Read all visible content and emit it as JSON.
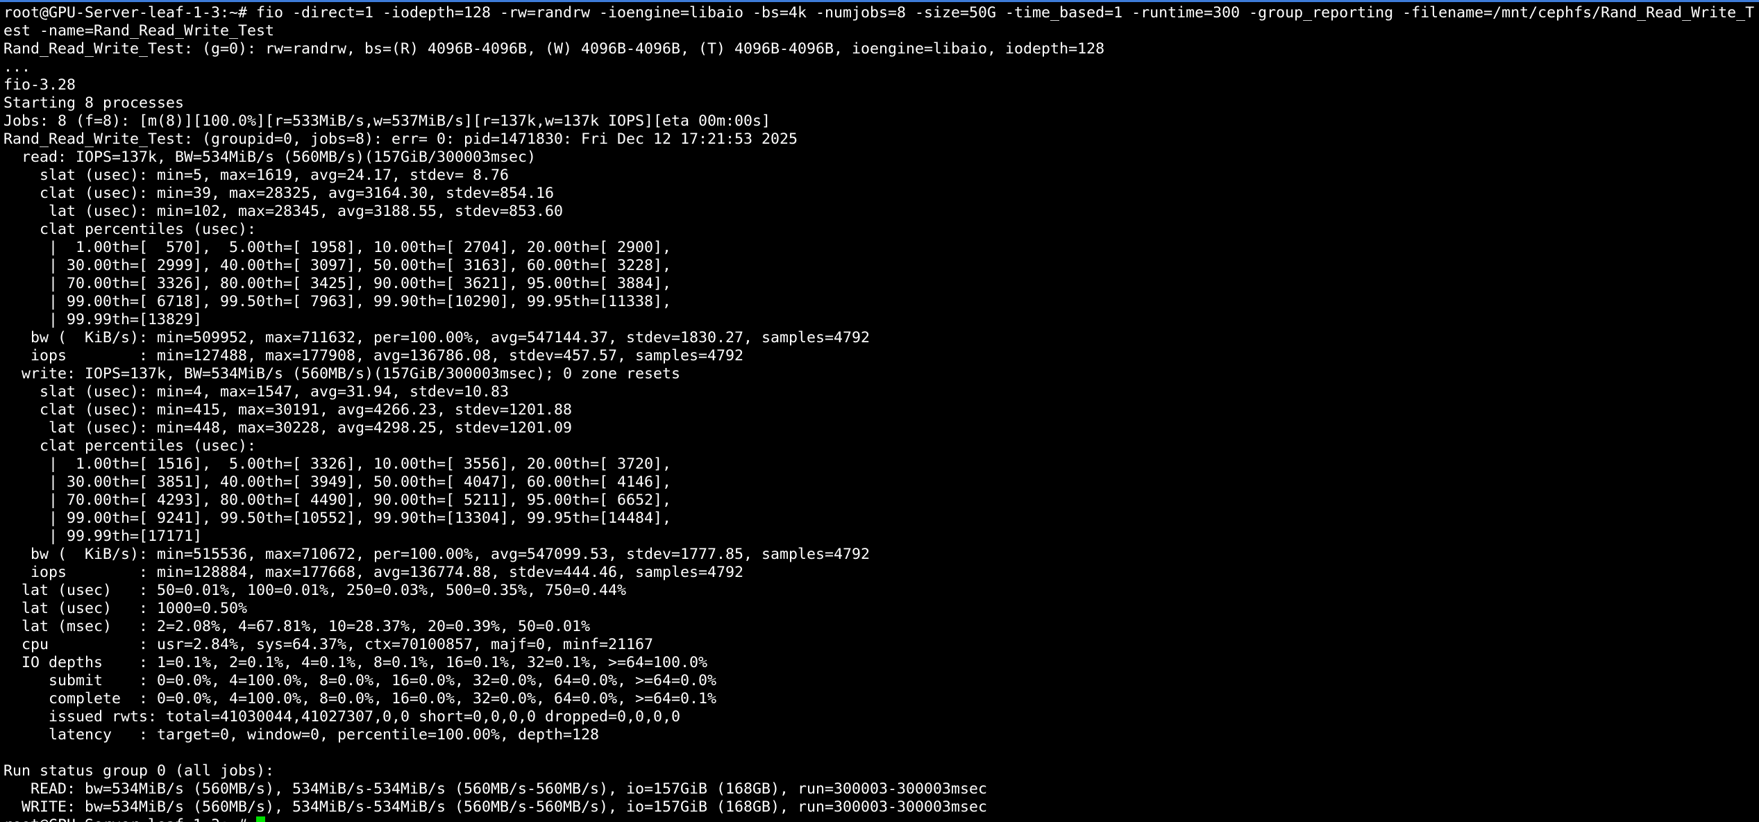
{
  "terminal": {
    "colors": {
      "background": "#000000",
      "text": "#ffffff",
      "cursor": "#00e000",
      "top_accent": "#3d7bd8"
    },
    "lines": [
      "root@GPU-Server-leaf-1-3:~# fio -direct=1 -iodepth=128 -rw=randrw -ioengine=libaio -bs=4k -numjobs=8 -size=50G -time_based=1 -runtime=300 -group_reporting -filename=/mnt/cephfs/Rand_Read_Write_T",
      "est -name=Rand_Read_Write_Test",
      "Rand_Read_Write_Test: (g=0): rw=randrw, bs=(R) 4096B-4096B, (W) 4096B-4096B, (T) 4096B-4096B, ioengine=libaio, iodepth=128",
      "...",
      "fio-3.28",
      "Starting 8 processes",
      "Jobs: 8 (f=8): [m(8)][100.0%][r=533MiB/s,w=537MiB/s][r=137k,w=137k IOPS][eta 00m:00s]",
      "Rand_Read_Write_Test: (groupid=0, jobs=8): err= 0: pid=1471830: Fri Dec 12 17:21:53 2025",
      "  read: IOPS=137k, BW=534MiB/s (560MB/s)(157GiB/300003msec)",
      "    slat (usec): min=5, max=1619, avg=24.17, stdev= 8.76",
      "    clat (usec): min=39, max=28325, avg=3164.30, stdev=854.16",
      "     lat (usec): min=102, max=28345, avg=3188.55, stdev=853.60",
      "    clat percentiles (usec):",
      "     |  1.00th=[  570],  5.00th=[ 1958], 10.00th=[ 2704], 20.00th=[ 2900],",
      "     | 30.00th=[ 2999], 40.00th=[ 3097], 50.00th=[ 3163], 60.00th=[ 3228],",
      "     | 70.00th=[ 3326], 80.00th=[ 3425], 90.00th=[ 3621], 95.00th=[ 3884],",
      "     | 99.00th=[ 6718], 99.50th=[ 7963], 99.90th=[10290], 99.95th=[11338],",
      "     | 99.99th=[13829]",
      "   bw (  KiB/s): min=509952, max=711632, per=100.00%, avg=547144.37, stdev=1830.27, samples=4792",
      "   iops        : min=127488, max=177908, avg=136786.08, stdev=457.57, samples=4792",
      "  write: IOPS=137k, BW=534MiB/s (560MB/s)(157GiB/300003msec); 0 zone resets",
      "    slat (usec): min=4, max=1547, avg=31.94, stdev=10.83",
      "    clat (usec): min=415, max=30191, avg=4266.23, stdev=1201.88",
      "     lat (usec): min=448, max=30228, avg=4298.25, stdev=1201.09",
      "    clat percentiles (usec):",
      "     |  1.00th=[ 1516],  5.00th=[ 3326], 10.00th=[ 3556], 20.00th=[ 3720],",
      "     | 30.00th=[ 3851], 40.00th=[ 3949], 50.00th=[ 4047], 60.00th=[ 4146],",
      "     | 70.00th=[ 4293], 80.00th=[ 4490], 90.00th=[ 5211], 95.00th=[ 6652],",
      "     | 99.00th=[ 9241], 99.50th=[10552], 99.90th=[13304], 99.95th=[14484],",
      "     | 99.99th=[17171]",
      "   bw (  KiB/s): min=515536, max=710672, per=100.00%, avg=547099.53, stdev=1777.85, samples=4792",
      "   iops        : min=128884, max=177668, avg=136774.88, stdev=444.46, samples=4792",
      "  lat (usec)   : 50=0.01%, 100=0.01%, 250=0.03%, 500=0.35%, 750=0.44%",
      "  lat (usec)   : 1000=0.50%",
      "  lat (msec)   : 2=2.08%, 4=67.81%, 10=28.37%, 20=0.39%, 50=0.01%",
      "  cpu          : usr=2.84%, sys=64.37%, ctx=70100857, majf=0, minf=21167",
      "  IO depths    : 1=0.1%, 2=0.1%, 4=0.1%, 8=0.1%, 16=0.1%, 32=0.1%, >=64=100.0%",
      "     submit    : 0=0.0%, 4=100.0%, 8=0.0%, 16=0.0%, 32=0.0%, 64=0.0%, >=64=0.0%",
      "     complete  : 0=0.0%, 4=100.0%, 8=0.0%, 16=0.0%, 32=0.0%, 64=0.0%, >=64=0.1%",
      "     issued rwts: total=41030044,41027307,0,0 short=0,0,0,0 dropped=0,0,0,0",
      "     latency   : target=0, window=0, percentile=100.00%, depth=128",
      "",
      "Run status group 0 (all jobs):",
      "   READ: bw=534MiB/s (560MB/s), 534MiB/s-534MiB/s (560MB/s-560MB/s), io=157GiB (168GB), run=300003-300003msec",
      "  WRITE: bw=534MiB/s (560MB/s), 534MiB/s-534MiB/s (560MB/s-560MB/s), io=157GiB (168GB), run=300003-300003msec"
    ],
    "prompt": "root@GPU-Server-leaf-1-3:~# "
  }
}
